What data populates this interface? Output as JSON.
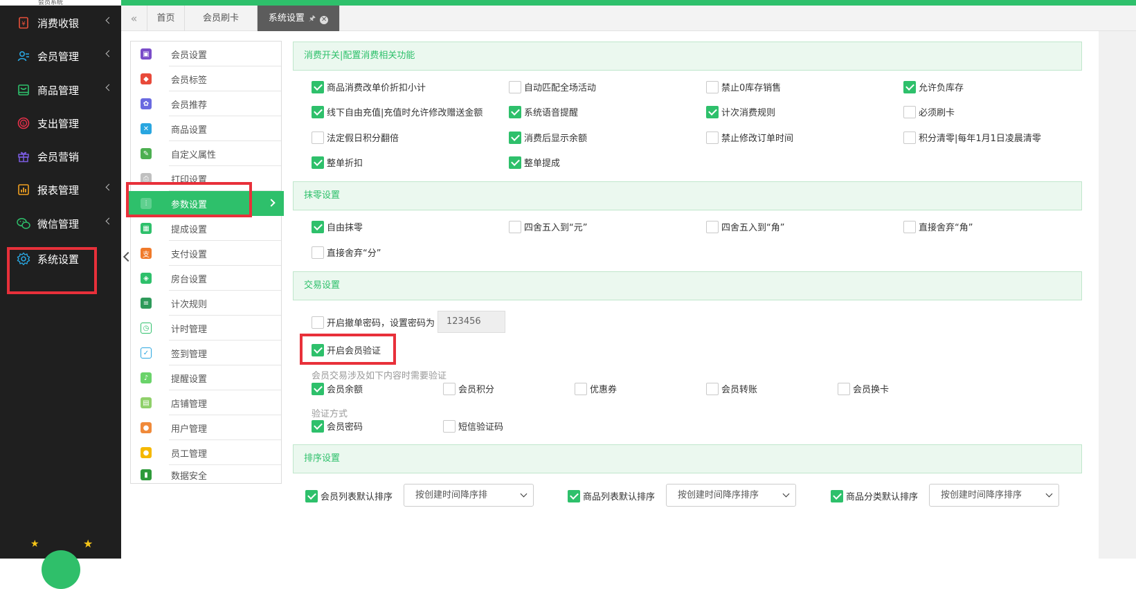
{
  "sidebar": {
    "logo_text": "会员系统",
    "items": [
      {
        "label": "消费收银",
        "icon": "cashier-icon"
      },
      {
        "label": "会员管理",
        "icon": "members-icon"
      },
      {
        "label": "商品管理",
        "icon": "goods-icon"
      },
      {
        "label": "支出管理",
        "icon": "expense-icon"
      },
      {
        "label": "会员营销",
        "icon": "gift-icon"
      },
      {
        "label": "报表管理",
        "icon": "report-icon"
      },
      {
        "label": "微信管理",
        "icon": "wechat-icon"
      },
      {
        "label": "系统设置",
        "icon": "gear-icon"
      }
    ]
  },
  "tabs": [
    {
      "label": "首页"
    },
    {
      "label": "会员刷卡"
    },
    {
      "label": "系统设置",
      "active": true
    }
  ],
  "submenu": [
    {
      "label": "会员设置"
    },
    {
      "label": "会员标签"
    },
    {
      "label": "会员推荐"
    },
    {
      "label": "商品设置"
    },
    {
      "label": "自定义属性"
    },
    {
      "label": "打印设置"
    },
    {
      "label": "参数设置",
      "active": true
    },
    {
      "label": "提成设置"
    },
    {
      "label": "支付设置"
    },
    {
      "label": "房台设置"
    },
    {
      "label": "计次规则"
    },
    {
      "label": "计时管理"
    },
    {
      "label": "签到管理"
    },
    {
      "label": "提醒设置"
    },
    {
      "label": "店铺管理"
    },
    {
      "label": "用户管理"
    },
    {
      "label": "员工管理"
    },
    {
      "label": "数据安全"
    }
  ],
  "sections": {
    "consume": {
      "title": "消费开关|配置消费相关功能",
      "options": [
        {
          "label": "商品消费改单价折扣小计",
          "checked": true
        },
        {
          "label": "自动匹配全场活动",
          "checked": false
        },
        {
          "label": "禁止0库存销售",
          "checked": false
        },
        {
          "label": "允许负库存",
          "checked": true
        },
        {
          "label": "线下自由充值|充值时允许修改赠送金额",
          "checked": true
        },
        {
          "label": "系统语音提醒",
          "checked": true
        },
        {
          "label": "计次消费规则",
          "checked": true
        },
        {
          "label": "必须刷卡",
          "checked": false
        },
        {
          "label": "法定假日积分翻倍",
          "checked": false
        },
        {
          "label": "消费后显示余额",
          "checked": true
        },
        {
          "label": "禁止修改订单时间",
          "checked": false
        },
        {
          "label": "积分清零|每年1月1日凌晨清零",
          "checked": false
        },
        {
          "label": "整单折扣",
          "checked": true
        },
        {
          "label": "整单提成",
          "checked": true
        }
      ]
    },
    "rounding": {
      "title": "抹零设置",
      "options": [
        {
          "label": "自由抹零",
          "checked": true
        },
        {
          "label": "四舍五入到“元”",
          "checked": false
        },
        {
          "label": "四舍五入到“角”",
          "checked": false
        },
        {
          "label": "直接舍弃“角”",
          "checked": false
        },
        {
          "label": "直接舍弃“分”",
          "checked": false
        }
      ]
    },
    "trade": {
      "title": "交易设置",
      "cancel_password": {
        "label": "开启撤单密码，设置密码为",
        "checked": false,
        "value": "123456"
      },
      "member_verify": {
        "label": "开启会员验证",
        "checked": true
      },
      "verify_hint": "会员交易涉及如下内容时需要验证",
      "verify_items": [
        {
          "label": "会员余额",
          "checked": true
        },
        {
          "label": "会员积分",
          "checked": false
        },
        {
          "label": "优惠券",
          "checked": false
        },
        {
          "label": "会员转账",
          "checked": false
        },
        {
          "label": "会员换卡",
          "checked": false
        }
      ],
      "method_hint": "验证方式",
      "methods": [
        {
          "label": "会员密码",
          "checked": true
        },
        {
          "label": "短信验证码",
          "checked": false
        }
      ]
    },
    "sort": {
      "title": "排序设置",
      "items": [
        {
          "label": "会员列表默认排序",
          "checked": true,
          "value": "按创建时间降序排"
        },
        {
          "label": "商品列表默认排序",
          "checked": true,
          "value": "按创建时间降序排序"
        },
        {
          "label": "商品分类默认排序",
          "checked": true,
          "value": "按创建时间降序排序"
        }
      ]
    }
  },
  "colors": {
    "accent": "#2ec06b",
    "sidebar_bg": "#1f1f1f",
    "highlight": "#e8303a"
  }
}
